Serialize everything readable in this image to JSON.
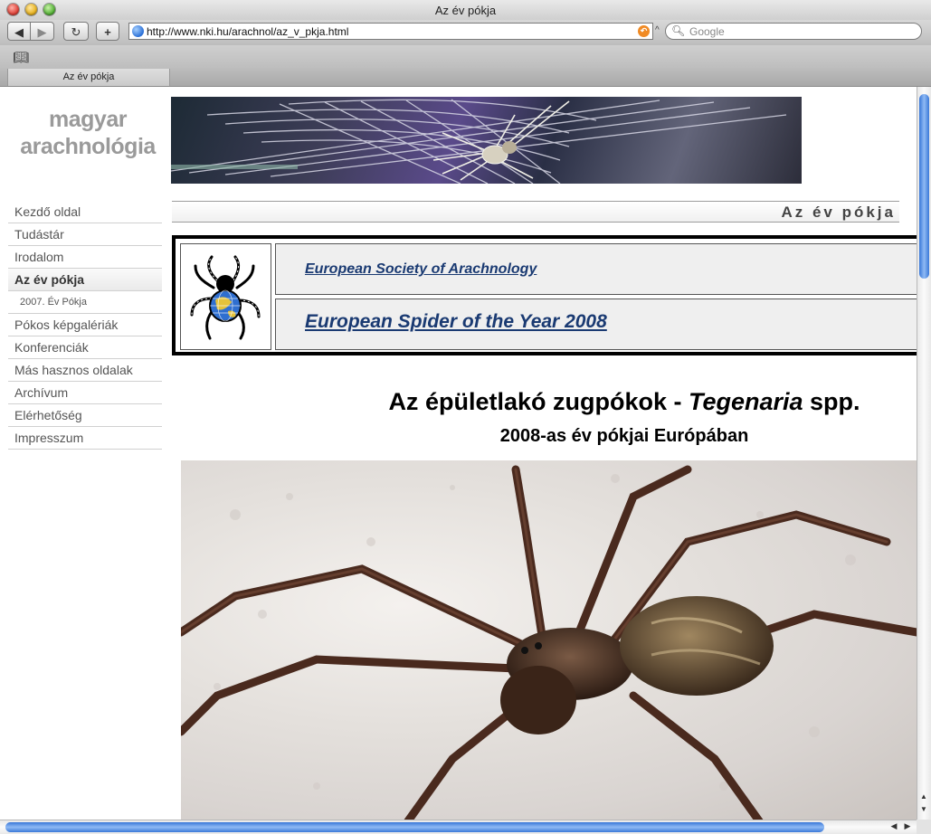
{
  "window": {
    "title": "Az év pókja"
  },
  "toolbar": {
    "back_icon": "back-arrow-icon",
    "forward_icon": "forward-arrow-icon",
    "reload_icon": "reload-icon",
    "add_icon": "plus-icon",
    "url": "http://www.nki.hu/arachnol/az_v_pkja.html",
    "search_placeholder": "Google"
  },
  "tab": {
    "label": "Az év pókja"
  },
  "site": {
    "logo_line1": "magyar",
    "logo_line2": "arachnológia"
  },
  "sidebar": {
    "items": [
      {
        "label": "Kezdő oldal"
      },
      {
        "label": "Tudástár"
      },
      {
        "label": "Irodalom"
      },
      {
        "label": "Az év pókja",
        "active": true
      },
      {
        "label": "2007. Év Pókja",
        "sub": true
      },
      {
        "label": "Pókos képgalériák"
      },
      {
        "label": "Konferenciák"
      },
      {
        "label": "Más hasznos oldalak"
      },
      {
        "label": "Archívum"
      },
      {
        "label": "Elérhetőség"
      },
      {
        "label": "Impresszum"
      }
    ]
  },
  "page": {
    "heading": "Az év pókja",
    "esa_link1": "European Society of Arachnology",
    "esa_link2": "European Spider of the Year 2008",
    "title_prefix": "Az épületlakó zugpókok - ",
    "title_italic": "Tegenaria",
    "title_suffix": " spp.",
    "subtitle": "2008-as év pókjai Európában"
  },
  "colors": {
    "link": "#1a3a72",
    "logo_text": "#9a9a9a",
    "scroll_thumb": "#3a78d8"
  }
}
